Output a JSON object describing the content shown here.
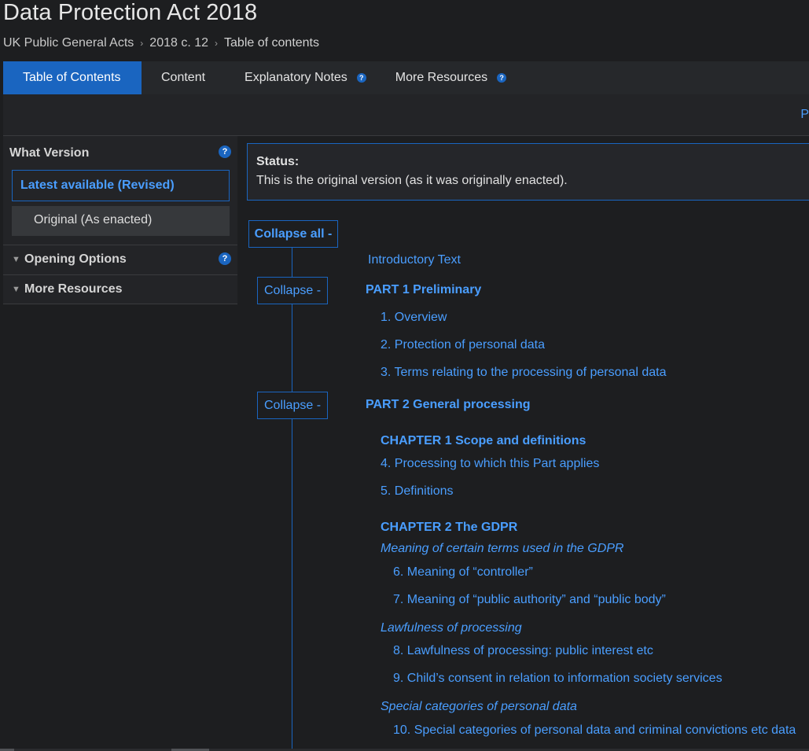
{
  "page": {
    "title": "Data Protection Act 2018"
  },
  "breadcrumb": {
    "items": [
      "UK Public General Acts",
      "2018 c. 12",
      "Table of contents"
    ]
  },
  "tabs": [
    {
      "label": "Table of Contents",
      "active": true
    },
    {
      "label": "Content",
      "active": false
    },
    {
      "label": "Explanatory Notes",
      "help": "?"
    },
    {
      "label": "More Resources",
      "help": "?"
    }
  ],
  "toolbar": {
    "partial_label": "P"
  },
  "sidebar": {
    "heading": "What Version",
    "help": "?",
    "versions": [
      {
        "label": "Latest available (Revised)",
        "selected": true
      },
      {
        "label": "Original (As enacted)",
        "selected": false
      }
    ],
    "sections": [
      {
        "label": "Opening Options",
        "help": "?"
      },
      {
        "label": "More Resources"
      }
    ]
  },
  "status": {
    "label": "Status:",
    "text": "This is the original version (as it was originally enacted)."
  },
  "controls": {
    "collapse_all": "Collapse all -",
    "collapse": "Collapse -"
  },
  "toc": {
    "intro": "Introductory Text",
    "part1": {
      "title": "PART 1 Preliminary",
      "items": [
        "1. Overview",
        "2. Protection of personal data",
        "3. Terms relating to the processing of personal data"
      ]
    },
    "part2": {
      "title": "PART 2 General processing",
      "chapter1": {
        "title": "CHAPTER 1 Scope and definitions",
        "items": [
          "4. Processing to which this Part applies",
          "5. Definitions"
        ]
      },
      "chapter2": {
        "title": "CHAPTER 2 The GDPR",
        "groups": [
          {
            "heading": "Meaning of certain terms used in the GDPR",
            "items": [
              "6. Meaning of “controller”",
              "7. Meaning of “public authority” and “public body”"
            ]
          },
          {
            "heading": "Lawfulness of processing",
            "items": [
              "8. Lawfulness of processing: public interest etc",
              "9. Child’s consent in relation to information society services"
            ]
          },
          {
            "heading": "Special categories of personal data",
            "items": [
              "10. Special categories of personal data and criminal convictions etc data"
            ]
          }
        ]
      }
    }
  },
  "colors": {
    "accent": "#1a65c0",
    "link": "#4a9eff",
    "background": "#1d1e20"
  }
}
